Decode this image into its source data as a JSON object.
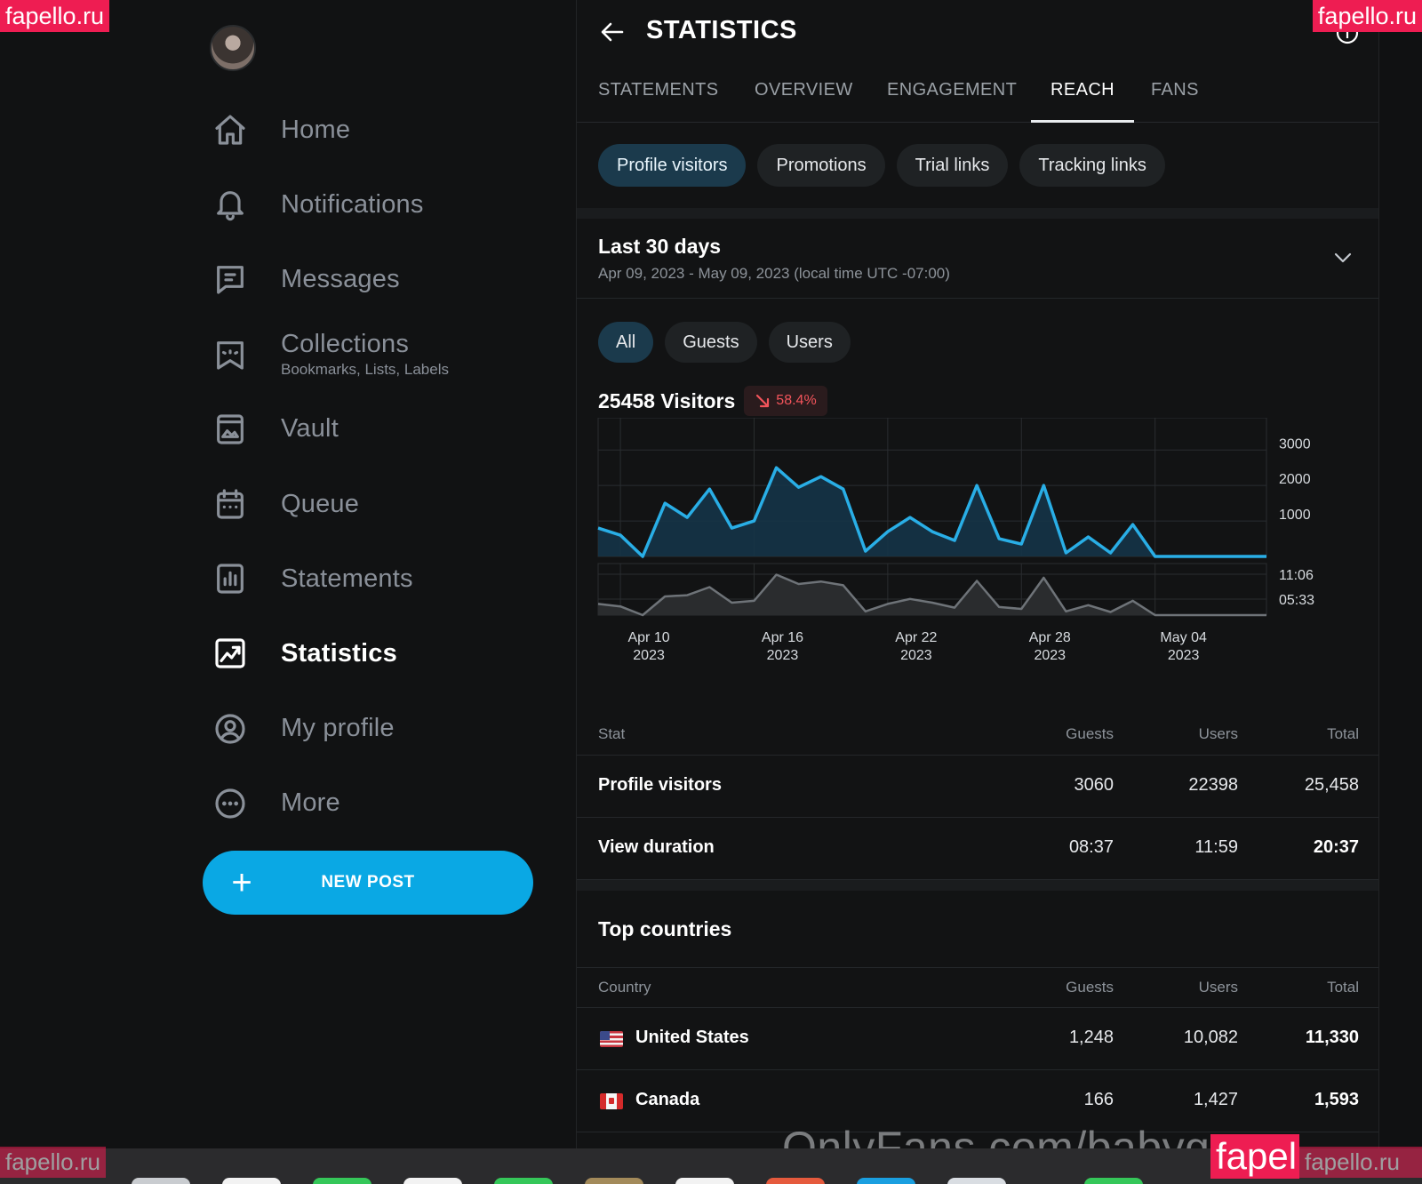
{
  "watermarks": {
    "top_left": "fapello.ru",
    "top_right": "fapello.ru",
    "bottom_left": "fapello.ru",
    "bottom_right": "fapello.ru",
    "bottom_big": "fapel",
    "onlyfans": "OnlyFans.com/babyg"
  },
  "sidebar": {
    "items": [
      {
        "label": "Home",
        "icon": "home-icon"
      },
      {
        "label": "Notifications",
        "icon": "bell-icon"
      },
      {
        "label": "Messages",
        "icon": "message-icon"
      },
      {
        "label": "Collections",
        "sub": "Bookmarks, Lists, Labels",
        "icon": "collections-icon"
      },
      {
        "label": "Vault",
        "icon": "vault-icon"
      },
      {
        "label": "Queue",
        "icon": "calendar-icon"
      },
      {
        "label": "Statements",
        "icon": "statements-icon"
      },
      {
        "label": "Statistics",
        "icon": "statistics-icon",
        "active": true
      },
      {
        "label": "My profile",
        "icon": "profile-icon"
      },
      {
        "label": "More",
        "icon": "more-icon"
      }
    ],
    "new_post": "NEW POST"
  },
  "header": {
    "title": "STATISTICS"
  },
  "tabs": [
    "STATEMENTS",
    "OVERVIEW",
    "ENGAGEMENT",
    "REACH",
    "FANS"
  ],
  "active_tab": "REACH",
  "subtabs": [
    "Profile visitors",
    "Promotions",
    "Trial links",
    "Tracking links"
  ],
  "active_subtab": "Profile visitors",
  "range": {
    "label": "Last 30 days",
    "dates": "Apr 09, 2023 - May 09, 2023 (local time UTC -07:00)"
  },
  "filters": [
    "All",
    "Guests",
    "Users"
  ],
  "active_filter": "All",
  "summary": {
    "visitors": "25458 Visitors",
    "change": "58.4%",
    "trend": "down"
  },
  "colors": {
    "accent": "#0aa8e4",
    "line": "#29aee6",
    "negative": "#f2545b"
  },
  "chart_data": {
    "type": "area",
    "x": [
      "Apr 9",
      "Apr 10",
      "Apr 11",
      "Apr 12",
      "Apr 13",
      "Apr 14",
      "Apr 15",
      "Apr 16",
      "Apr 17",
      "Apr 18",
      "Apr 19",
      "Apr 20",
      "Apr 21",
      "Apr 22",
      "Apr 23",
      "Apr 24",
      "Apr 25",
      "Apr 26",
      "Apr 27",
      "Apr 28",
      "Apr 29",
      "Apr 30",
      "May 1",
      "May 2",
      "May 3",
      "May 4",
      "May 5",
      "May 6",
      "May 7",
      "May 8",
      "May 9"
    ],
    "series": [
      {
        "values": [
          800,
          600,
          0,
          1500,
          1100,
          1900,
          800,
          1000,
          2500,
          1950,
          2250,
          1900,
          150,
          700,
          1100,
          700,
          450,
          2000,
          500,
          350,
          2000,
          100,
          550,
          100,
          900,
          0,
          0,
          0,
          0,
          0,
          0
        ]
      }
    ],
    "secondary": {
      "type": "area",
      "y_ticks": [
        "11:06",
        "05:33"
      ],
      "values": [
        1.8,
        1.4,
        0,
        3.0,
        3.2,
        4.5,
        2.0,
        2.3,
        6.5,
        5.0,
        5.4,
        4.8,
        0.6,
        1.8,
        2.6,
        2.0,
        1.2,
        5.5,
        1.3,
        1.0,
        6.0,
        0.6,
        1.6,
        0.5,
        2.3,
        0,
        0,
        0,
        0,
        0,
        0
      ]
    },
    "y_ticks": [
      3000,
      2000,
      1000
    ],
    "ylim": [
      0,
      3000
    ],
    "x_ticks": [
      {
        "l1": "Apr 10",
        "l2": "2023",
        "i": 1
      },
      {
        "l1": "Apr 16",
        "l2": "2023",
        "i": 7
      },
      {
        "l1": "Apr 22",
        "l2": "2023",
        "i": 13
      },
      {
        "l1": "Apr 28",
        "l2": "2023",
        "i": 19
      },
      {
        "l1": "May 04",
        "l2": "2023",
        "i": 25
      }
    ],
    "grid": true
  },
  "stats_table": {
    "headers": [
      "Stat",
      "Guests",
      "Users",
      "Total"
    ],
    "rows": [
      {
        "stat": "Profile visitors",
        "guests": "3060",
        "users": "22398",
        "total": "25,458"
      },
      {
        "stat": "View duration",
        "guests": "08:37",
        "users": "11:59",
        "total": "20:37"
      }
    ]
  },
  "countries": {
    "title": "Top countries",
    "headers": [
      "Country",
      "Guests",
      "Users",
      "Total"
    ],
    "rows": [
      {
        "country": "United States",
        "guests": "1,248",
        "users": "10,082",
        "total": "11,330",
        "flag": "us-flag-icon"
      },
      {
        "country": "Canada",
        "guests": "166",
        "users": "1,427",
        "total": "1,593",
        "flag": "ca-flag-icon"
      }
    ]
  }
}
